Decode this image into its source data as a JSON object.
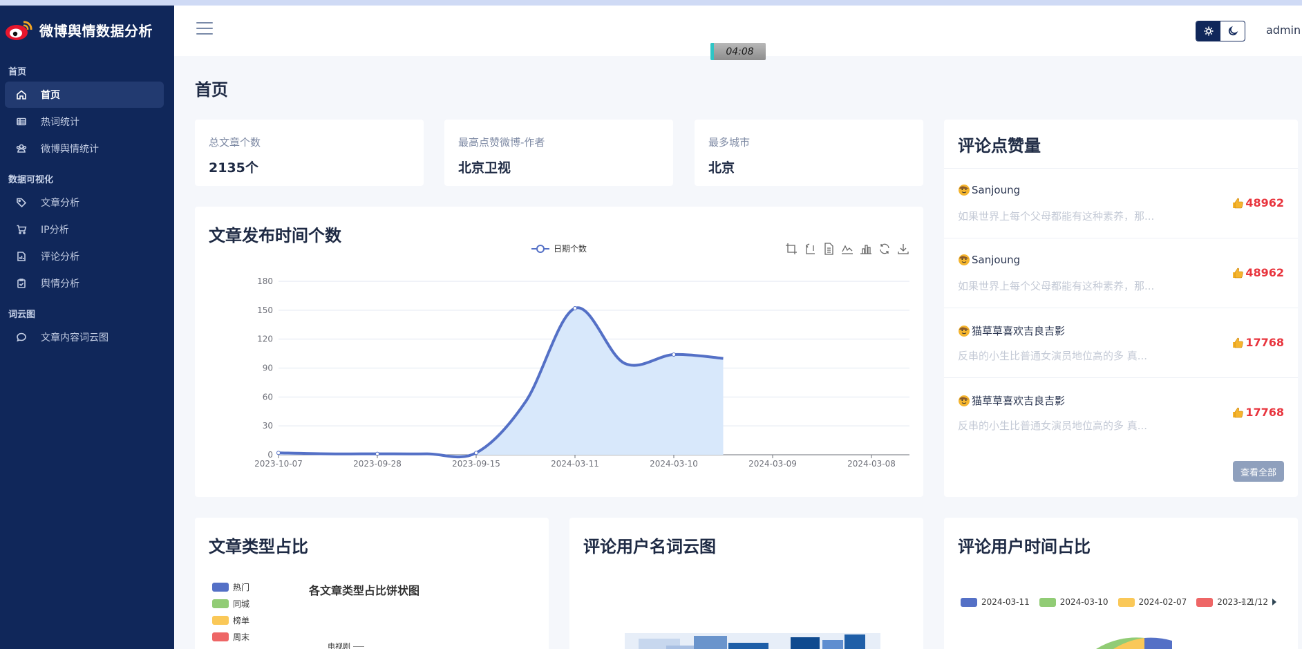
{
  "brand": {
    "name": "微博舆情数据分析"
  },
  "sidebar": {
    "sections": [
      {
        "title": "首页"
      },
      {
        "title": "数据可视化"
      },
      {
        "title": "词云图"
      }
    ],
    "items": [
      {
        "label": "首页",
        "icon": "home-icon"
      },
      {
        "label": "热词统计",
        "icon": "table-icon"
      },
      {
        "label": "微博舆情统计",
        "icon": "users-icon"
      },
      {
        "label": "文章分析",
        "icon": "tag-icon"
      },
      {
        "label": "IP分析",
        "icon": "cart-icon"
      },
      {
        "label": "评论分析",
        "icon": "chart-file-icon"
      },
      {
        "label": "舆情分析",
        "icon": "clipboard-check-icon"
      },
      {
        "label": "文章内容词云图",
        "icon": "message-icon"
      }
    ]
  },
  "header": {
    "user": "admin",
    "timer": "04:08"
  },
  "page": {
    "title": "首页"
  },
  "stats": [
    {
      "label": "总文章个数",
      "value": "2135个"
    },
    {
      "label": "最高点赞微博-作者",
      "value": "北京卫视"
    },
    {
      "label": "最多城市",
      "value": "北京"
    }
  ],
  "time_chart": {
    "title": "文章发布时间个数",
    "legend": "日期个数"
  },
  "comments_card": {
    "title": "评论点赞量",
    "view_all": "查看全部",
    "items": [
      {
        "user": "Sanjoung",
        "text": "如果世界上每个父母都能有这种素养，那...",
        "likes": "48962"
      },
      {
        "user": "Sanjoung",
        "text": "如果世界上每个父母都能有这种素养，那...",
        "likes": "48962"
      },
      {
        "user": "猫草草喜欢吉良吉影",
        "text": "反串的小生比普通女演员地位高的多 真...",
        "likes": "17768"
      },
      {
        "user": "猫草草喜欢吉良吉影",
        "text": "反串的小生比普通女演员地位高的多 真...",
        "likes": "17768"
      }
    ]
  },
  "type_card": {
    "title": "文章类型占比",
    "chart_title": "各文章类型占比饼状图",
    "legend": [
      "热门",
      "同城",
      "榜单",
      "周末"
    ],
    "legend_colors": [
      "#5470c6",
      "#91cc75",
      "#fac858",
      "#ee6666"
    ],
    "partial_label": "电视剧"
  },
  "wordcloud_card": {
    "title": "评论用户名词云图"
  },
  "user_time_card": {
    "title": "评论用户时间占比",
    "legend": [
      "2024-03-11",
      "2024-03-10",
      "2024-02-07",
      "2023-12"
    ],
    "legend_colors": [
      "#5470c6",
      "#91cc75",
      "#fac858",
      "#ee6666"
    ],
    "pager": "1/12"
  },
  "chart_data": {
    "type": "area",
    "title": "文章发布时间个数",
    "series": [
      {
        "name": "日期个数",
        "values": [
          2,
          1,
          1,
          1,
          2,
          55,
          152,
          95,
          104,
          100
        ]
      }
    ],
    "x": [
      "2023-10-07",
      "",
      "2023-09-28",
      "",
      "2023-09-15",
      "2024-03-11",
      "2024-03-10",
      "2024-03-09",
      "2024-03-08",
      ""
    ],
    "tick_labels": [
      "2023-10-07",
      "2023-09-28",
      "2023-09-15",
      "2024-03-11",
      "2024-03-10",
      "2024-03-09",
      "2024-03-08"
    ],
    "yticks": [
      0,
      30,
      60,
      90,
      120,
      150,
      180
    ],
    "ylim": [
      0,
      180
    ],
    "grid": true,
    "color": "#5470c6",
    "fill": "#d8e8fb"
  }
}
